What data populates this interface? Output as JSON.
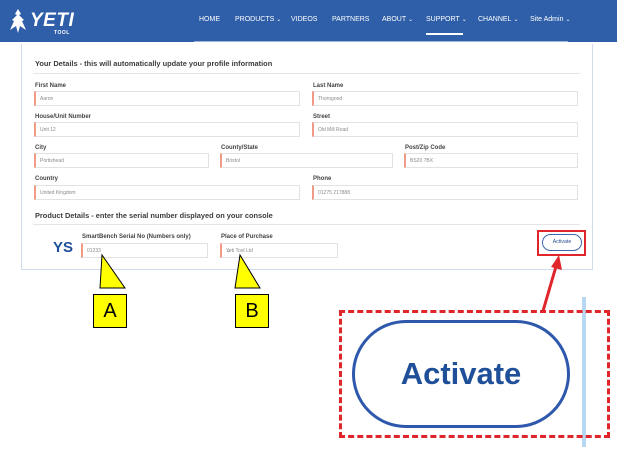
{
  "nav": {
    "logo_text": "YETI",
    "logo_sub": "TOOL",
    "items": [
      {
        "label": "HOME",
        "chevron": ""
      },
      {
        "label": "PRODUCTS",
        "chevron": "⌄"
      },
      {
        "label": "VIDEOS",
        "chevron": ""
      },
      {
        "label": "PARTNERS",
        "chevron": ""
      },
      {
        "label": "ABOUT",
        "chevron": "⌄"
      },
      {
        "label": "SUPPORT",
        "chevron": "⌄"
      },
      {
        "label": "CHANNEL",
        "chevron": "⌄"
      },
      {
        "label": "Site Admin",
        "chevron": "⌄"
      }
    ],
    "active": "SUPPORT"
  },
  "details": {
    "title": "Your Details - this will automatically update your profile information",
    "first_name": {
      "label": "First Name",
      "value": "Aaron"
    },
    "last_name": {
      "label": "Last Name",
      "value": "Thorogood"
    },
    "house": {
      "label": "House/Unit Number",
      "value": "Unit 12"
    },
    "street": {
      "label": "Street",
      "value": "Old Mill Road"
    },
    "city": {
      "label": "City",
      "value": "Portishead"
    },
    "county": {
      "label": "County/State",
      "value": "Bristol"
    },
    "postcode": {
      "label": "Post/Zip Code",
      "value": "BS20 7BX"
    },
    "country": {
      "label": "Country",
      "value": "United Kingdom"
    },
    "phone": {
      "label": "Phone",
      "value": "01275 217888"
    }
  },
  "product": {
    "title": "Product Details - enter the serial number displayed on your console",
    "prefix": "YS",
    "serial": {
      "label": "SmartBench Serial No (Numbers only)",
      "value": "01233"
    },
    "place": {
      "label": "Place of Purchase",
      "value": "Yeti Tool Ltd",
      "chevron": "⌄"
    },
    "activate_label": "Activate"
  },
  "annotations": {
    "callout_a": "A",
    "callout_b": "B",
    "zoom_label": "Activate"
  },
  "colors": {
    "nav_bg": "#2f5fa8",
    "accent": "#1f4f99",
    "highlight_red": "#e0262a",
    "callout_yellow": "#ffff00"
  }
}
